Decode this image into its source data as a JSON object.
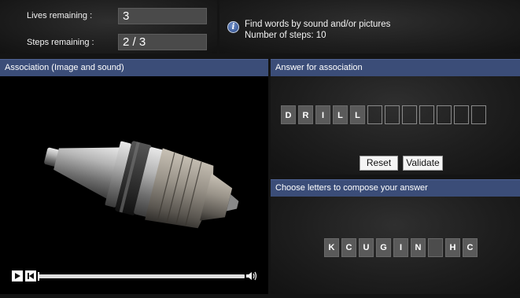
{
  "stats": {
    "lives_label": "Lives remaining :",
    "lives_value": "3",
    "steps_label": "Steps remaining :",
    "steps_value": "2 / 3"
  },
  "info": {
    "icon": "info-icon",
    "line1": "Find words by sound and/or pictures",
    "line2": "Number of steps: 10"
  },
  "association": {
    "header": "Association (Image and sound)",
    "image": "drill-chuck-image",
    "player": {
      "play_icon": "play-icon",
      "rewind_icon": "rewind-icon",
      "volume_icon": "volume-icon",
      "progress": 0
    }
  },
  "answer": {
    "header": "Answer for association",
    "slots": [
      "D",
      "R",
      "I",
      "L",
      "L",
      "",
      "",
      "",
      "",
      "",
      "",
      ""
    ],
    "reset_label": "Reset",
    "validate_label": "Validate"
  },
  "compose": {
    "header": "Choose letters to compose your answer",
    "letters": [
      "K",
      "C",
      "U",
      "G",
      "I",
      "N",
      "",
      "H",
      "C"
    ]
  },
  "colors": {
    "header_bg": "#3b4d78",
    "tile_bg": "#5a5a5a"
  }
}
